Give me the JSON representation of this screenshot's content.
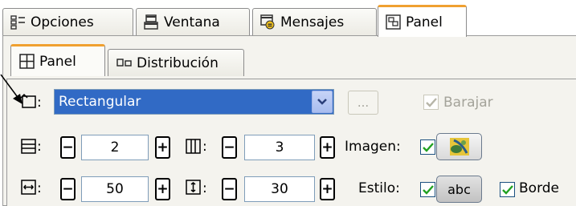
{
  "tabs": [
    "Opciones",
    "Ventana",
    "Mensajes",
    "Panel"
  ],
  "subtabs": [
    "Panel",
    "Distribución"
  ],
  "shape": {
    "label": ":",
    "value": "Rectangular",
    "browse": "...",
    "shuffle": "Barajar",
    "shuffle_checked": true
  },
  "rows": {
    "label": ":",
    "value": "2"
  },
  "cols": {
    "label": ":",
    "value": "3"
  },
  "width": {
    "label": ":",
    "value": "50"
  },
  "height": {
    "label": ":",
    "value": "30"
  },
  "image": {
    "label": "Imagen:",
    "checked": true
  },
  "style": {
    "label": "Estilo:",
    "checked": true,
    "sample": "abc"
  },
  "border": {
    "label": "Borde",
    "checked": true
  },
  "spin": {
    "minus": "−",
    "plus": "+"
  }
}
